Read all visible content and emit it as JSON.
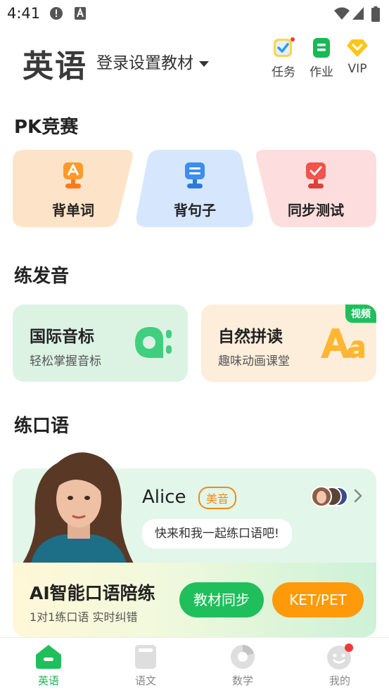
{
  "status_bar": {
    "time": "4:41",
    "icons": [
      "alert-icon",
      "a-text-icon",
      "wifi-icon",
      "signal-icon",
      "battery-icon"
    ]
  },
  "header": {
    "subject": "英语",
    "textbook_selector": "登录设置教材",
    "actions": [
      {
        "label": "任务",
        "icon": "task-checklist-icon",
        "has_dot": true
      },
      {
        "label": "作业",
        "icon": "homework-icon"
      },
      {
        "label": "VIP",
        "icon": "vip-diamond-icon"
      }
    ]
  },
  "pk_section": {
    "title": "PK竞赛",
    "cards": [
      {
        "label": "背单词",
        "icon": "trophy-a-icon",
        "color": "#fde4c8"
      },
      {
        "label": "背句子",
        "icon": "trophy-lines-icon",
        "color": "#d6e7fd"
      },
      {
        "label": "同步测试",
        "icon": "trophy-check-icon",
        "color": "#fddddd"
      }
    ]
  },
  "pronunciation_section": {
    "title": "练发音",
    "cards": [
      {
        "title": "国际音标",
        "subtitle": "轻松掌握音标",
        "icon": "phonetic-a-icon",
        "color": "#dcf3e4"
      },
      {
        "title": "自然拼读",
        "subtitle": "趣味动画课堂",
        "icon": "aa-letters-icon",
        "badge": "视频",
        "color": "#fdeedb"
      }
    ]
  },
  "speaking_section": {
    "title": "练口语",
    "tutor": {
      "name": "Alice",
      "accent": "美音",
      "message": "快来和我一起练口语吧!"
    },
    "ai_title": "AI智能口语陪练",
    "ai_subtitle": "1对1练口语 实时纠错",
    "buttons": [
      {
        "label": "教材同步",
        "color": "#1fbf5c"
      },
      {
        "label": "KET/PET",
        "color": "#ff9a0a"
      }
    ]
  },
  "bottom_nav": {
    "items": [
      {
        "label": "英语",
        "icon": "home-icon",
        "active": true
      },
      {
        "label": "语文",
        "icon": "book-icon",
        "active": false
      },
      {
        "label": "数学",
        "icon": "pie-icon",
        "active": false
      },
      {
        "label": "我的",
        "icon": "smile-icon",
        "active": false,
        "has_dot": true
      }
    ]
  },
  "colors": {
    "brand_green": "#1fbf5c",
    "orange": "#ff9a0a"
  }
}
